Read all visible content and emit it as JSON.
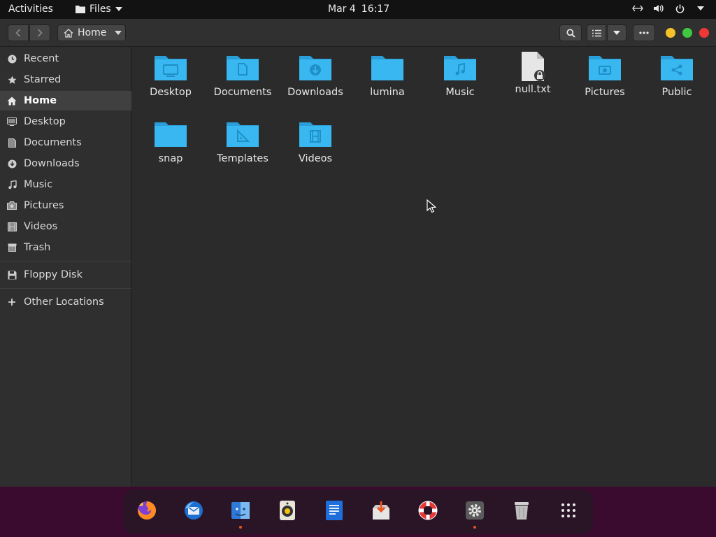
{
  "topbar": {
    "activities": "Activities",
    "app_name": "Files",
    "date": "Mar 4",
    "time": "16:17",
    "icons": [
      "network-icon",
      "volume-icon",
      "power-icon",
      "system-menu-chevron-icon"
    ]
  },
  "headerbar": {
    "path_label": "Home",
    "icons": [
      "back-icon",
      "forward-icon",
      "home-icon",
      "search-icon",
      "list-view-icon",
      "chevron-down-icon",
      "more-icon"
    ]
  },
  "sidebar": {
    "items": [
      {
        "label": "Recent",
        "icon": "clock-icon"
      },
      {
        "label": "Starred",
        "icon": "star-icon"
      },
      {
        "label": "Home",
        "icon": "home-icon",
        "active": true
      },
      {
        "label": "Desktop",
        "icon": "desktop-icon"
      },
      {
        "label": "Documents",
        "icon": "document-icon"
      },
      {
        "label": "Downloads",
        "icon": "download-icon"
      },
      {
        "label": "Music",
        "icon": "music-icon"
      },
      {
        "label": "Pictures",
        "icon": "camera-icon"
      },
      {
        "label": "Videos",
        "icon": "film-icon"
      },
      {
        "label": "Trash",
        "icon": "trash-icon"
      }
    ],
    "devices": [
      {
        "label": "Floppy Disk",
        "icon": "floppy-icon"
      }
    ],
    "other": {
      "label": "Other Locations",
      "icon": "plus-icon"
    }
  },
  "files": [
    {
      "name": "Desktop",
      "type": "folder",
      "emblem": "desktop"
    },
    {
      "name": "Documents",
      "type": "folder",
      "emblem": "document"
    },
    {
      "name": "Downloads",
      "type": "folder",
      "emblem": "download"
    },
    {
      "name": "lumina",
      "type": "folder",
      "emblem": ""
    },
    {
      "name": "Music",
      "type": "folder",
      "emblem": "music"
    },
    {
      "name": "null.txt",
      "type": "file",
      "emblem": "lock"
    },
    {
      "name": "Pictures",
      "type": "folder",
      "emblem": "picture"
    },
    {
      "name": "Public",
      "type": "folder",
      "emblem": "share"
    },
    {
      "name": "snap",
      "type": "folder",
      "emblem": ""
    },
    {
      "name": "Templates",
      "type": "folder",
      "emblem": "template"
    },
    {
      "name": "Videos",
      "type": "folder",
      "emblem": "video"
    }
  ],
  "dock": [
    {
      "app": "firefox-icon",
      "running": false
    },
    {
      "app": "thunderbird-icon",
      "running": false
    },
    {
      "app": "files-icon",
      "running": true
    },
    {
      "app": "rhythmbox-icon",
      "running": false
    },
    {
      "app": "writer-icon",
      "running": false
    },
    {
      "app": "software-icon",
      "running": false
    },
    {
      "app": "help-icon",
      "running": false
    },
    {
      "app": "settings-icon",
      "running": true
    },
    {
      "app": "trash-icon",
      "running": false
    },
    {
      "app": "app-grid-icon",
      "running": false
    }
  ],
  "colors": {
    "folder": "#39b7f0",
    "folder_dark": "#2a9ed8",
    "accent": "#e95420",
    "dock_bg": "#3a0b2f"
  }
}
